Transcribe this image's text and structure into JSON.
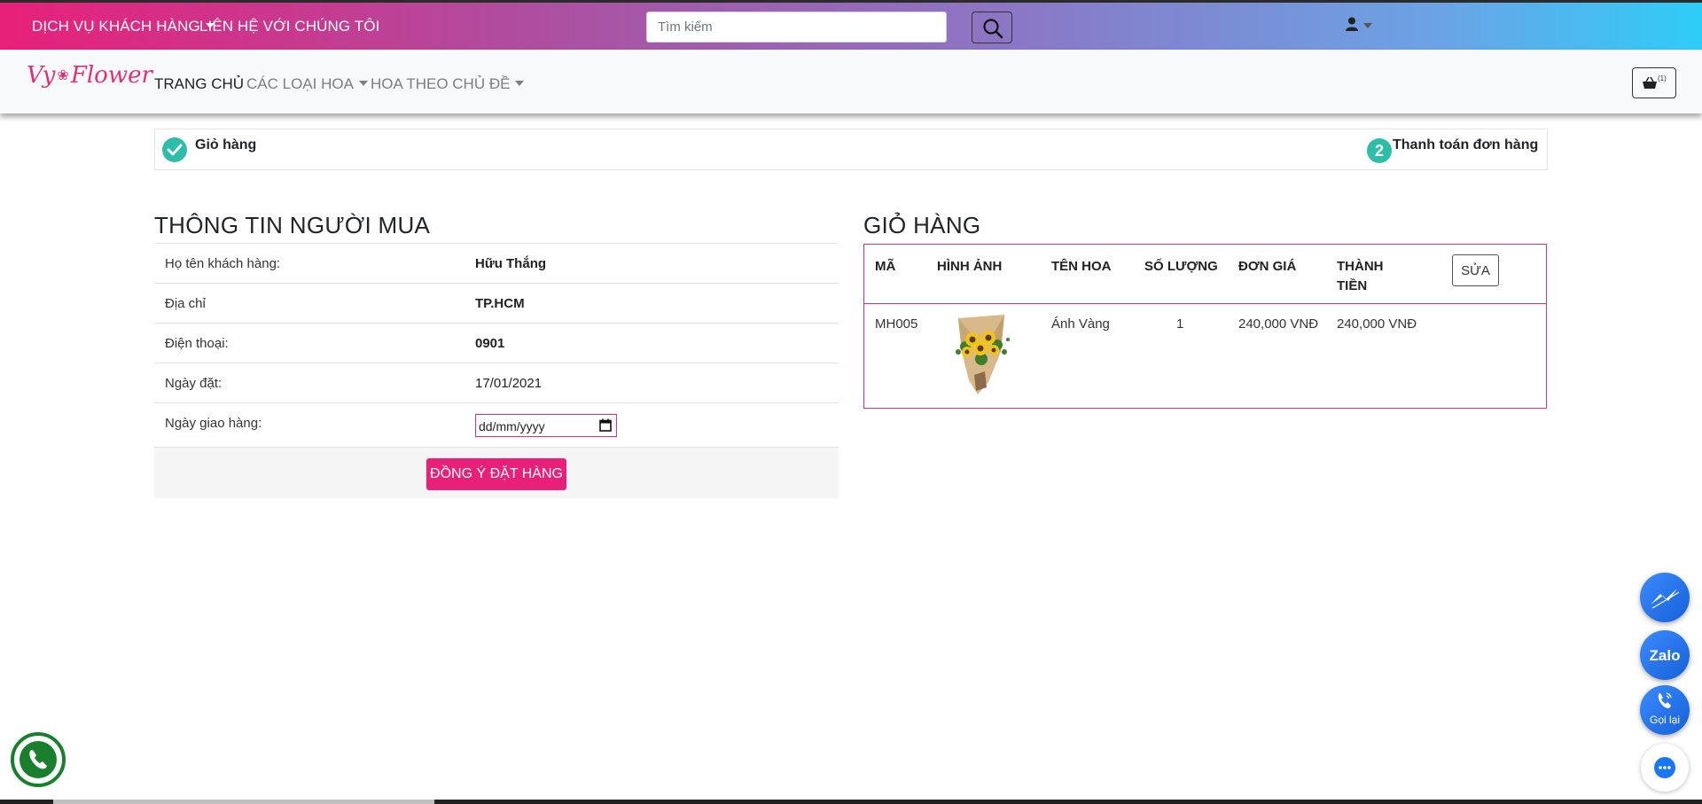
{
  "topbar": {
    "customer_service": "DỊCH VỤ KHÁCH HÀNG",
    "contact": "LIÊN HỆ VỚI CHÚNG TÔI",
    "search_placeholder": "Tìm kiếm",
    "icons": {
      "search": "search-icon",
      "user": "user-icon"
    }
  },
  "navbar": {
    "logo_left": "Vy",
    "logo_right": "Flower",
    "items": [
      {
        "label": "TRANG CHỦ",
        "active": true
      },
      {
        "label": "CÁC LOẠI HOA",
        "dropdown": true
      },
      {
        "label": "HOA THEO CHỦ ĐỀ",
        "dropdown": true
      }
    ],
    "cart_count": "(1)"
  },
  "steps": {
    "step1": "Giỏ hàng",
    "step2_number": "2",
    "step2": "Thanh toán đơn hàng"
  },
  "buyer": {
    "title": "THÔNG TIN NGƯỜI MUA",
    "rows": [
      {
        "label": "Họ tên khách hàng:",
        "value": "Hữu Thắng"
      },
      {
        "label": "Địa chỉ",
        "value": "TP.HCM"
      },
      {
        "label": "Điện thoại:",
        "value": "0901"
      },
      {
        "label": "Ngày đặt:",
        "value": "17/01/2021"
      },
      {
        "label": "Ngày giao hàng:",
        "value": "dd/mm/yyyy"
      }
    ],
    "order_button": "ĐỒNG Ý ĐẶT HÀNG"
  },
  "cart": {
    "title": "GIỎ HÀNG",
    "headers": [
      "MÃ",
      "HÌNH ẢNH",
      "TÊN HOA",
      "SỐ LƯỢNG",
      "ĐƠN GIÁ",
      "THÀNH",
      "TIỀN"
    ],
    "edit_button": "SỬA",
    "row": {
      "code": "MH005",
      "name": "Ánh Vàng",
      "quantity": "1",
      "unit_price": "240,000 VNĐ",
      "total": "240,000 VNĐ"
    }
  },
  "floating": {
    "zalo": "Zalo",
    "callback": "Gọi lại"
  },
  "colors": {
    "brand_pink": "#e8207a",
    "teal": "#2dbda8",
    "fab_blue": "#1560d8"
  }
}
